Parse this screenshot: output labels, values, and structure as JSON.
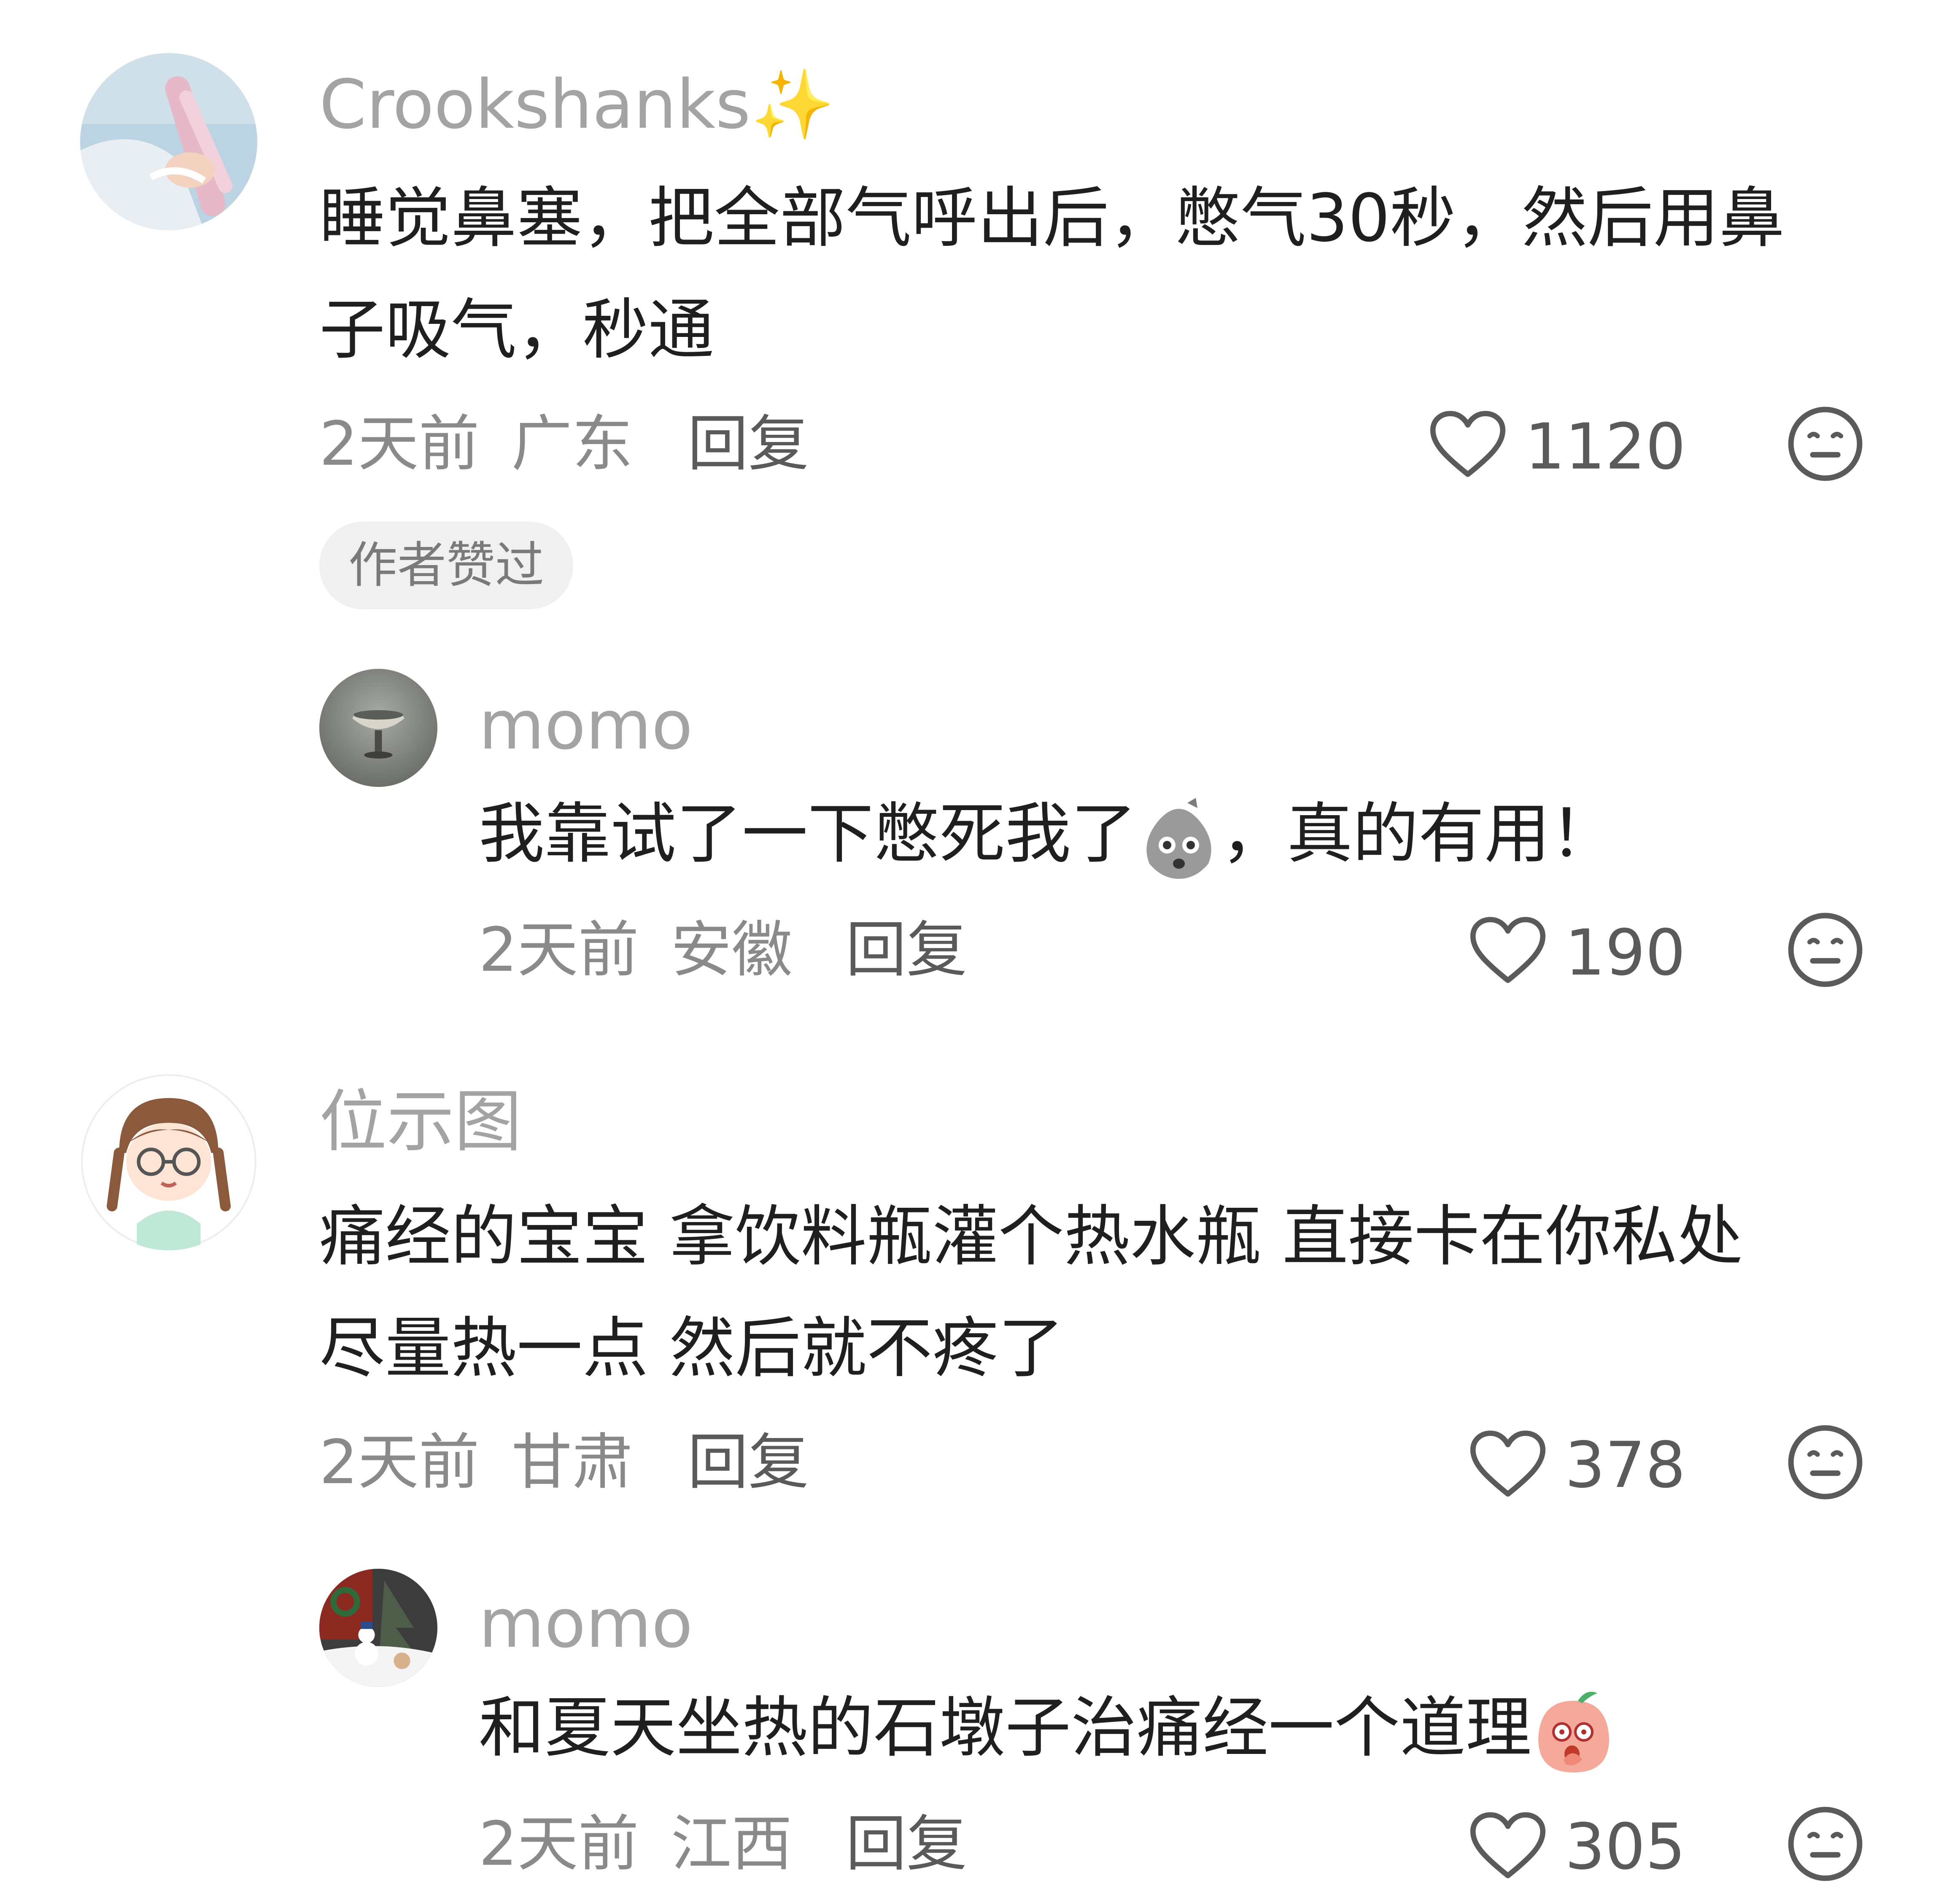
{
  "comments": [
    {
      "username": "Crookshanks",
      "username_decoration": "✨",
      "text_line1": "睡觉鼻塞，把全部气呼出后，憋气30秒，然后用鼻",
      "text_line2": "子吸气，秒通",
      "time": "2天前",
      "location": "广东",
      "reply_label": "回复",
      "likes": "1120",
      "badge": "作者赞过",
      "avatar_icon": "photo-hand-flowers-avatar",
      "like_icon": "heart-outline-icon",
      "dislike_icon": "meh-face-icon"
    },
    {
      "username": "momo",
      "text_before_emoji": "我靠试了一下憋死我了",
      "emoji_name": "shocked-bag-emoji",
      "text_after_emoji": "，真的有用！",
      "time": "2天前",
      "location": "安徽",
      "reply_label": "回复",
      "likes": "190",
      "avatar_icon": "photo-goblet-avatar",
      "like_icon": "heart-outline-icon",
      "dislike_icon": "meh-face-icon"
    },
    {
      "username": "位示图",
      "text_line1": "痛经的宝宝 拿饮料瓶灌个热水瓶 直接卡在你私处",
      "text_line2": "尽量热一点 然后就不疼了",
      "time": "2天前",
      "location": "甘肃",
      "reply_label": "回复",
      "likes": "378",
      "avatar_icon": "cartoon-girl-glasses-avatar",
      "like_icon": "heart-outline-icon",
      "dislike_icon": "meh-face-icon"
    },
    {
      "username": "momo",
      "text_before_emoji": "和夏天坐热的石墩子治痛经一个道理",
      "emoji_name": "peach-blush-emoji",
      "time": "2天前",
      "location": "江西",
      "reply_label": "回复",
      "likes": "305",
      "avatar_icon": "photo-snowman-avatar",
      "like_icon": "heart-outline-icon",
      "dislike_icon": "meh-face-icon"
    }
  ],
  "colors": {
    "text_primary": "#1f1f1f",
    "text_secondary": "#8a8a8a",
    "username": "#a3a3a3",
    "badge_bg": "#f0f0f0"
  }
}
